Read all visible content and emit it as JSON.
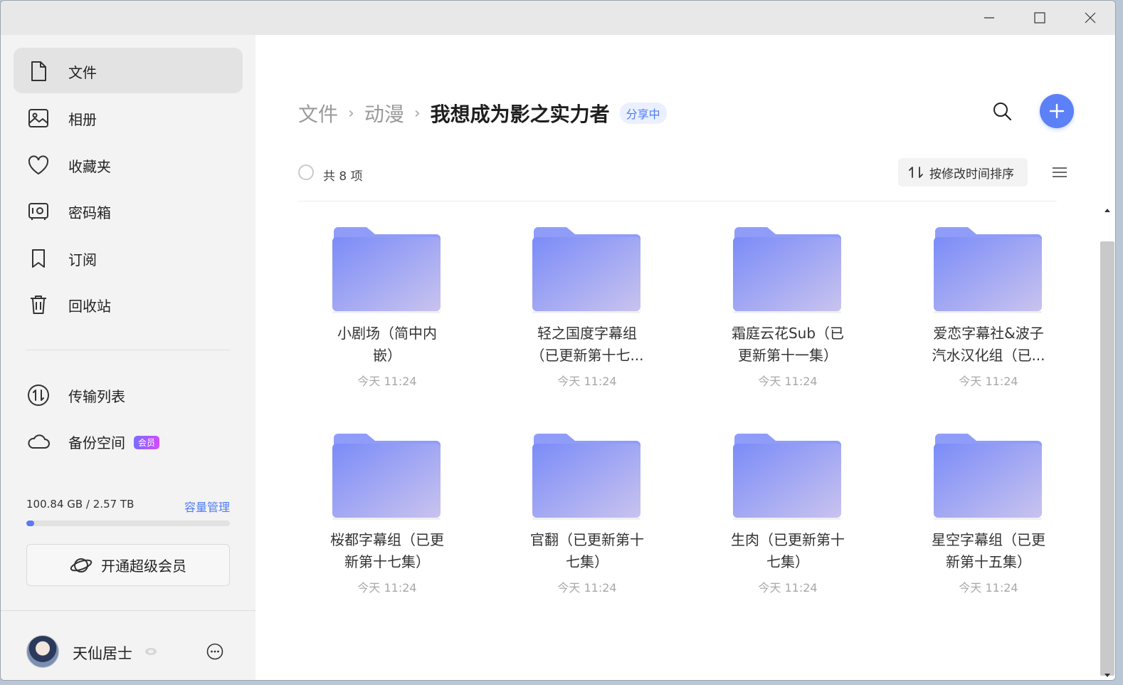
{
  "sidebar": {
    "items": [
      {
        "label": "文件",
        "icon": "file-icon",
        "active": true
      },
      {
        "label": "相册",
        "icon": "photo-album-icon"
      },
      {
        "label": "收藏夹",
        "icon": "heart-icon"
      },
      {
        "label": "密码箱",
        "icon": "safe-icon"
      },
      {
        "label": "订阅",
        "icon": "bookmark-icon"
      },
      {
        "label": "回收站",
        "icon": "trash-icon"
      }
    ],
    "tools": [
      {
        "label": "传输列表",
        "icon": "transfer-icon"
      },
      {
        "label": "备份空间",
        "icon": "cloud-icon",
        "badge": "会员"
      }
    ],
    "storage": {
      "usage_text": "100.84 GB / 2.57 TB",
      "manage_label": "容量管理",
      "used_fraction": 0.038
    },
    "vip_button_label": "开通超级会员",
    "user": {
      "name": "天仙居士"
    }
  },
  "header": {
    "breadcrumb": [
      "文件",
      "动漫"
    ],
    "current_folder": "我想成为影之实力者",
    "share_status": "分享中"
  },
  "toolbar": {
    "count_label": "共 8 项",
    "sort_label": "按修改时间排序"
  },
  "files": [
    {
      "name_lines": [
        "小剧场（简中内",
        "嵌）"
      ],
      "time": "今天 11:24"
    },
    {
      "name_lines": [
        "轻之国度字幕组",
        "（已更新第十七..."
      ],
      "time": "今天 11:24"
    },
    {
      "name_lines": [
        "霜庭云花Sub（已",
        "更新第十一集）"
      ],
      "time": "今天 11:24"
    },
    {
      "name_lines": [
        "爱恋字幕社&波子",
        "汽水汉化组（已..."
      ],
      "time": "今天 11:24"
    },
    {
      "name_lines": [
        "桜都字幕组（已更",
        "新第十七集）"
      ],
      "time": "今天 11:24"
    },
    {
      "name_lines": [
        "官翻（已更新第十",
        "七集）"
      ],
      "time": "今天 11:24"
    },
    {
      "name_lines": [
        "生肉（已更新第十",
        "七集）"
      ],
      "time": "今天 11:24"
    },
    {
      "name_lines": [
        "星空字幕组（已更",
        "新第十五集）"
      ],
      "time": "今天 11:24"
    }
  ],
  "colors": {
    "accent": "#5c80f6",
    "folder_start": "#7b8cf8",
    "folder_end": "#c9c3ee",
    "sidebar_bg": "#f3f3f3"
  }
}
